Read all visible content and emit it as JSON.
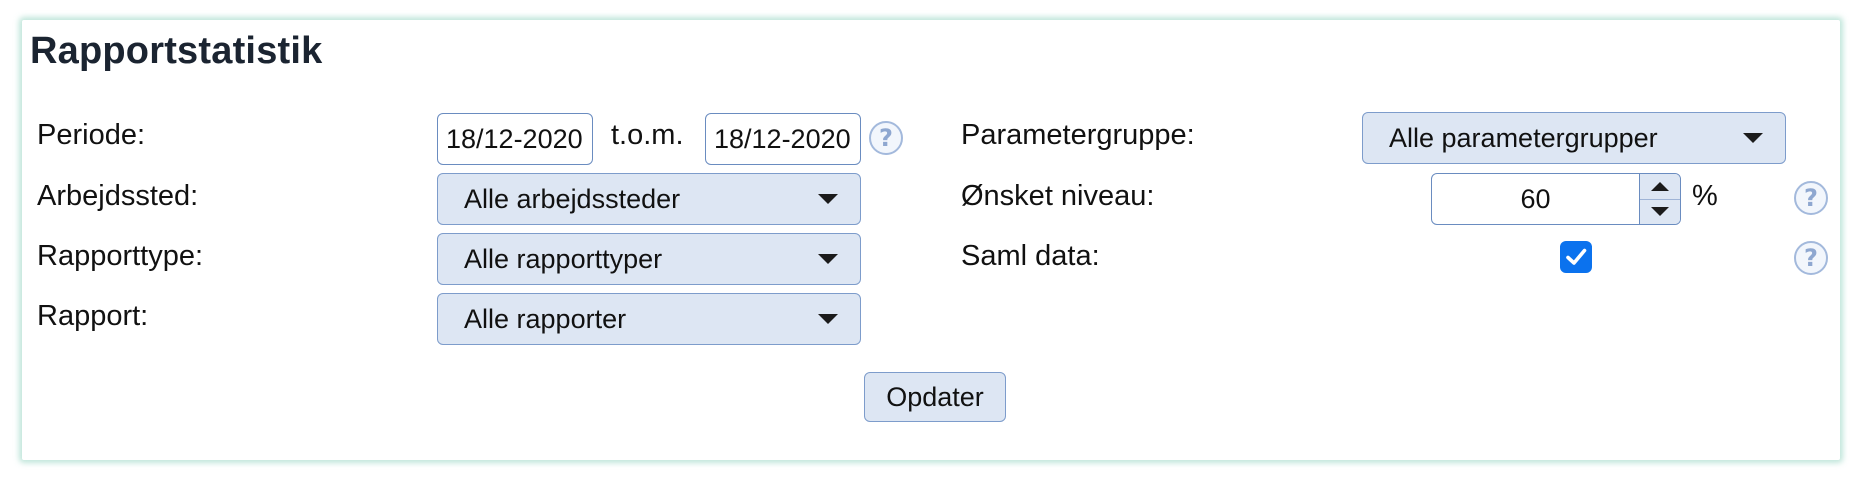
{
  "title": "Rapportstatistik",
  "left": {
    "period_label": "Periode:",
    "date_from": "18/12-2020",
    "date_to_sep": "t.o.m.",
    "date_to": "18/12-2020",
    "workplace_label": "Arbejdssted:",
    "workplace_value": "Alle arbejdssteder",
    "reporttype_label": "Rapporttype:",
    "reporttype_value": "Alle rapporttyper",
    "report_label": "Rapport:",
    "report_value": "Alle rapporter"
  },
  "right": {
    "paramgroup_label": "Parametergruppe:",
    "paramgroup_value": "Alle parametergrupper",
    "level_label": "Ønsket niveau:",
    "level_value": "60",
    "level_unit": "%",
    "collect_label": "Saml data:",
    "collect_checked": true
  },
  "help_glyph": "?",
  "update_button": "Opdater",
  "colors": {
    "checkbox": "#0b72ee",
    "select_bg": "#dde6f3",
    "border": "#6a8cc0",
    "help": "#8ea7d0"
  }
}
